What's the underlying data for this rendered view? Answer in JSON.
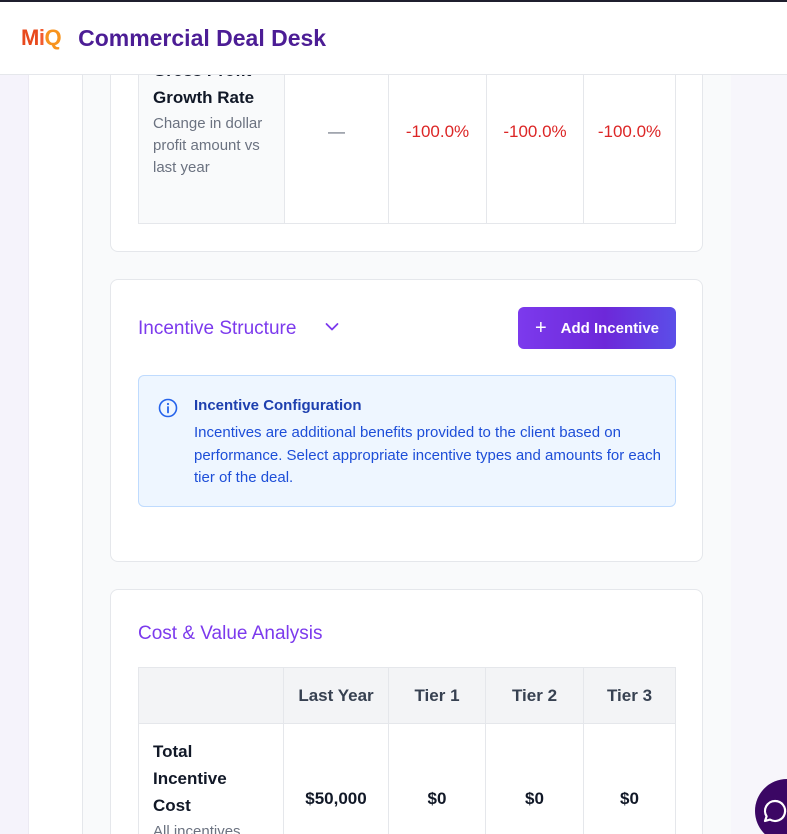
{
  "header": {
    "logo_m": "M",
    "logo_i": "i",
    "logo_q": "Q",
    "title": "Commercial Deal Desk"
  },
  "growth_row": {
    "name": "Gross Profit Growth Rate",
    "description": "Change in dollar profit amount vs last year",
    "last_year": "—",
    "tier1": "-100.0%",
    "tier2": "-100.0%",
    "tier3": "-100.0%"
  },
  "incentive": {
    "title": "Incentive Structure",
    "add_label": "Add Incentive",
    "info_title": "Incentive Configuration",
    "info_text": "Incentives are additional benefits provided to the client based on performance. Select appropriate incentive types and amounts for each tier of the deal."
  },
  "cost": {
    "title": "Cost & Value Analysis",
    "columns": [
      "",
      "Last Year",
      "Tier 1",
      "Tier 2",
      "Tier 3"
    ],
    "rows": [
      {
        "name": "Total Incentive Cost",
        "description": "All incentives applied to this",
        "values": [
          "$50,000",
          "$0",
          "$0",
          "$0"
        ]
      }
    ]
  },
  "colors": {
    "brand_purple": "#4c1d95",
    "accent_violet": "#7c3aed",
    "negative_red": "#dc2626",
    "info_blue": "#1e40af"
  },
  "icons": {
    "chevron": "chevron-down-icon",
    "info": "info-icon",
    "plus": "plus-icon",
    "chat": "chat-icon"
  }
}
